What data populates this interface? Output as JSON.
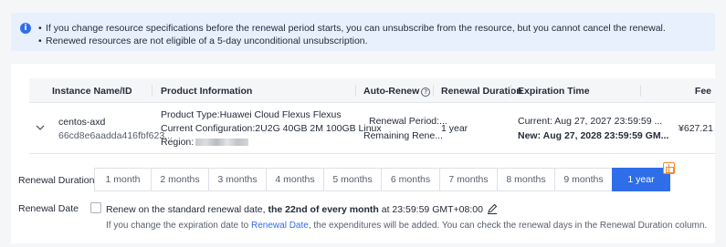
{
  "notice": {
    "lines": [
      "If you change resource specifications before the renewal period starts, you can unsubscribe from the resource, but you cannot cancel the renewal.",
      "Renewed resources are not eligible of a 5-day unconditional unsubscription."
    ]
  },
  "table": {
    "headers": {
      "instance": "Instance Name/ID",
      "product": "Product Information",
      "auto_renew": "Auto-Renew",
      "renewal_duration": "Renewal Duration",
      "expiration": "Expiration Time",
      "fee": "Fee"
    },
    "row": {
      "name": "centos-axd",
      "id": "66cd8e6aadda416fbf623...",
      "product_type": "Product Type:Huawei Cloud Flexus Flexus",
      "configuration": "Current Configuration:2U2G 40GB 2M 100GB Linux",
      "region_label": "Region:",
      "auto_renew_period": "Renewal Period:...",
      "auto_renew_remaining": "Remaining Rene...",
      "renewal_duration": "1 year",
      "expiration_current": "Current: Aug 27, 2027 23:59:59 ...",
      "expiration_new": "New: Aug 27, 2028 23:59:59 GM...",
      "fee": "¥627.21"
    }
  },
  "renewal": {
    "duration_label": "Renewal Duration",
    "options": [
      "1 month",
      "2 months",
      "3 months",
      "4 months",
      "5 months",
      "6 months",
      "7 months",
      "8 months",
      "9 months",
      "1 year"
    ],
    "selected": "1 year",
    "date_label": "Renewal Date",
    "date_prefix": "Renew on the standard renewal date, ",
    "date_bold": "the 22nd of every month",
    "date_suffix": " at 23:59:59 GMT+08:00",
    "hint_prefix": "If you change the expiration date to ",
    "hint_link": "Renewal Date",
    "hint_suffix": ", the expenditures will be added. You can check the renewal days in the Renewal Duration column."
  },
  "colors": {
    "accent": "#2f6ee8",
    "notice_bg": "#e8f0fe",
    "gift": "#f0892d"
  }
}
